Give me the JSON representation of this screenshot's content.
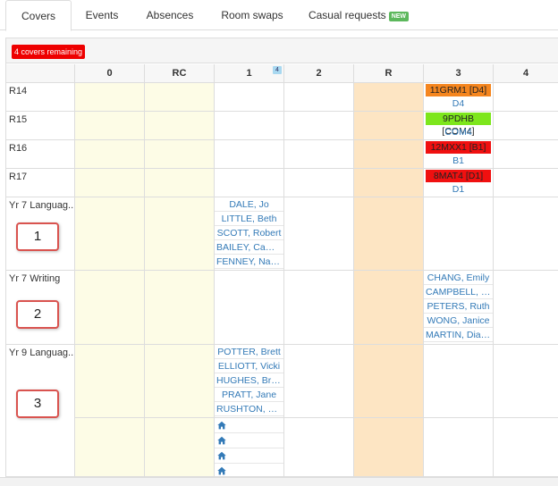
{
  "tabs": [
    {
      "label": "Covers",
      "active": true
    },
    {
      "label": "Events"
    },
    {
      "label": "Absences"
    },
    {
      "label": "Room swaps"
    },
    {
      "label": "Casual requests",
      "badge": "NEW"
    }
  ],
  "toolbar": {
    "remaining_label": "4 covers remaining"
  },
  "columns": [
    "",
    "0",
    "RC",
    "1",
    "2",
    "R",
    "3",
    "4"
  ],
  "column_counts": {
    "1": "4"
  },
  "rows": [
    {
      "label": "R14",
      "lesson": {
        "col": "3",
        "text": "11GRM1 [D4]",
        "color": "#f5861f",
        "room": "D4"
      }
    },
    {
      "label": "R15",
      "lesson": {
        "col": "3",
        "text": "9PDHB [COM4]",
        "color": "#7de61c",
        "room": "COM4"
      }
    },
    {
      "label": "R16",
      "lesson": {
        "col": "3",
        "text": "12MXX1 [B1]",
        "color": "#f01010",
        "room": "B1"
      }
    },
    {
      "label": "R17",
      "lesson": {
        "col": "3",
        "text": "8MAT4 [D1]",
        "color": "#f01010",
        "room": "D1"
      }
    },
    {
      "label": "Yr 7 Languag...",
      "staff_col": "1",
      "staff": [
        "DALE, Jo",
        "LITTLE, Beth",
        "SCOTT, Robert",
        "BAILEY, Came...",
        "FENNEY, Nath..."
      ]
    },
    {
      "label": "Yr 7 Writing",
      "staff_col": "3",
      "staff": [
        "CHANG, Emily",
        "CAMPBELL, Li...",
        "PETERS, Ruth",
        "WONG, Janice",
        "MARTIN, Diane"
      ]
    },
    {
      "label": "Yr 9 Languag...",
      "staff_col": "1",
      "staff": [
        "POTTER, Brett",
        "ELLIOTT, Vicki",
        "HUGHES, Brian",
        "PRATT, Jane",
        "RUSHTON, Brad"
      ]
    }
  ],
  "annotations": [
    "1",
    "2",
    "3"
  ],
  "icons": {
    "home": "home-icon"
  }
}
